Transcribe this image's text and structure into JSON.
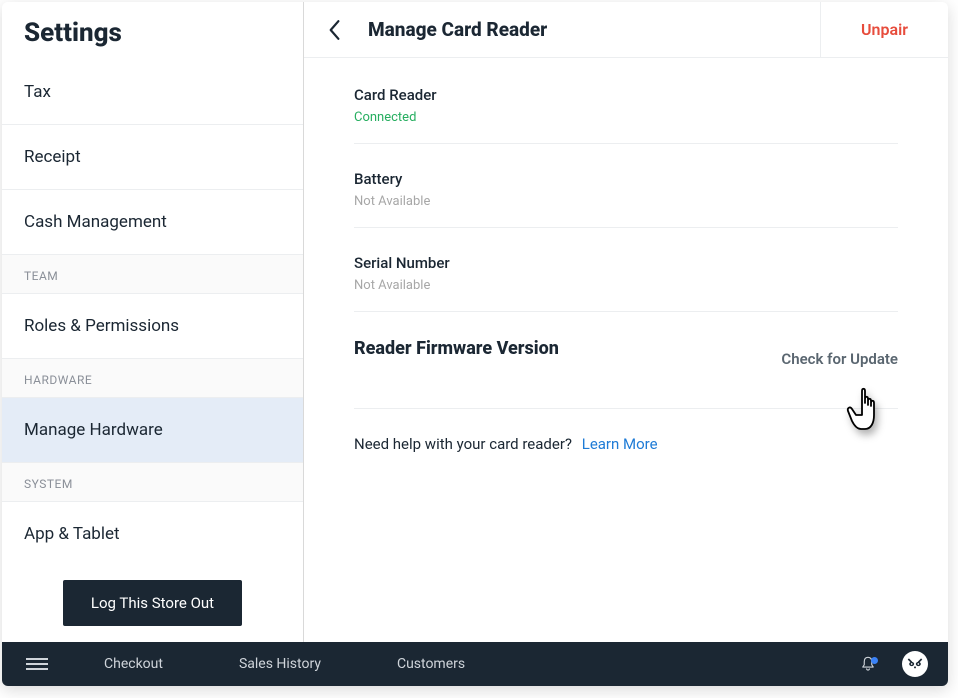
{
  "sidebar": {
    "title": "Settings",
    "items": [
      {
        "label": "Tax",
        "selected": false
      },
      {
        "label": "Receipt",
        "selected": false
      },
      {
        "label": "Cash Management",
        "selected": false
      }
    ],
    "team_header": "TEAM",
    "team_items": [
      {
        "label": "Roles & Permissions",
        "selected": false
      }
    ],
    "hardware_header": "HARDWARE",
    "hardware_items": [
      {
        "label": "Manage Hardware",
        "selected": true
      }
    ],
    "system_header": "SYSTEM",
    "system_items": [
      {
        "label": "App & Tablet",
        "selected": false
      }
    ],
    "logout_label": "Log This Store Out"
  },
  "content": {
    "title": "Manage Card Reader",
    "unpair_label": "Unpair",
    "card_reader": {
      "label": "Card Reader",
      "status": "Connected"
    },
    "battery": {
      "label": "Battery",
      "value": "Not Available"
    },
    "serial": {
      "label": "Serial Number",
      "value": "Not Available"
    },
    "firmware": {
      "label": "Reader Firmware Version",
      "check_update": "Check for Update"
    },
    "help": {
      "text": "Need help with your card reader?",
      "link": "Learn More"
    }
  },
  "bottombar": {
    "items": [
      "Checkout",
      "Sales History",
      "Customers"
    ]
  }
}
